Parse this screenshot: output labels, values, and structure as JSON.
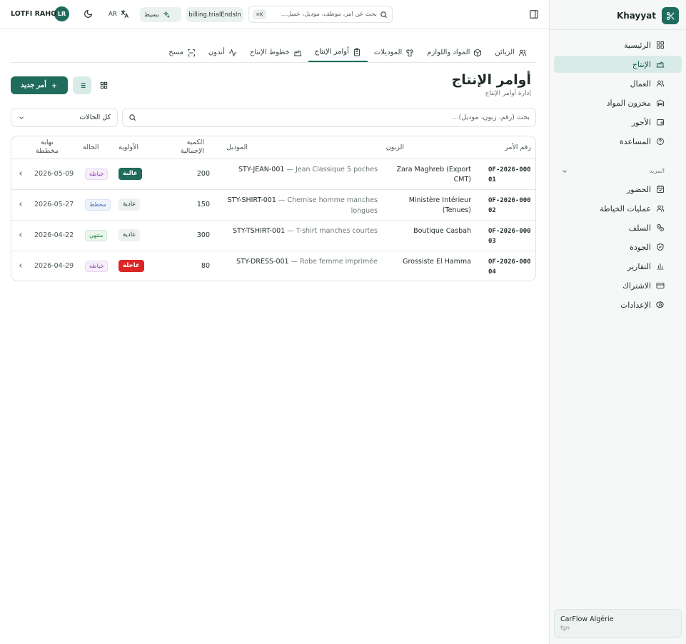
{
  "app": {
    "name": "Khayyat"
  },
  "sidebar": {
    "main_items": [
      {
        "label": "الرئيسية",
        "icon": "dashboard-icon"
      },
      {
        "label": "الإنتاج",
        "icon": "factory-icon",
        "active": true
      },
      {
        "label": "العمال",
        "icon": "users-icon"
      },
      {
        "label": "مخزون المواد",
        "icon": "warehouse-icon"
      },
      {
        "label": "الأجور",
        "icon": "wallet-icon"
      },
      {
        "label": "المساعدة",
        "icon": "help-circle-icon"
      }
    ],
    "more_label": "المزيد",
    "more_items": [
      {
        "label": "الحضور",
        "icon": "calendar-check-icon"
      },
      {
        "label": "عمليات الخياطة",
        "icon": "users-icon"
      },
      {
        "label": "السلف",
        "icon": "coins-icon"
      },
      {
        "label": "الجودة",
        "icon": "shield-check-icon"
      },
      {
        "label": "التقارير",
        "icon": "bar-chart-icon"
      },
      {
        "label": "الاشتراك",
        "icon": "credit-card-icon"
      },
      {
        "label": "الإعدادات",
        "icon": "settings-icon"
      }
    ],
    "org": {
      "name": "CarFlow Algérie",
      "sub": "fgn"
    }
  },
  "topbar": {
    "search_placeholder": "بحث عن أمر، موظف، موديل، عميل...",
    "search_shortcut": "⌘K",
    "billing_label": "billing.trialEndsIn",
    "mode_label": "بسيط",
    "language": "AR",
    "user_initials": "LR",
    "user_name": "LOTFI RAHO"
  },
  "tabs": [
    {
      "label": "الزبائن",
      "icon": "users-icon"
    },
    {
      "label": "المواد واللوازم",
      "icon": "package-icon"
    },
    {
      "label": "الموديلات",
      "icon": "shirt-icon"
    },
    {
      "label": "أوامر الإنتاج",
      "icon": "clipboard-icon",
      "active": true
    },
    {
      "label": "خطوط الإنتاج",
      "icon": "factory-icon"
    },
    {
      "label": "أندون",
      "icon": "activity-icon"
    },
    {
      "label": "مسح",
      "icon": "scan-icon"
    }
  ],
  "page": {
    "title": "أوامر الإنتاج",
    "subtitle": "إدارة أوامر الإنتاج",
    "new_button": "أمر جديد"
  },
  "filters": {
    "search_placeholder": "بحث (رقم، زبون، موديل)...",
    "status_value": "كل الحالات"
  },
  "table": {
    "headers": {
      "order": "رقم الأمر",
      "client": "الزبون",
      "model": "الموديل",
      "qty": "الكمية الإجمالية",
      "priority": "الأولوية",
      "status": "الحالة",
      "end": "نهاية مخططة"
    },
    "rows": [
      {
        "order": "OF-2026-00001",
        "client": "Zara Maghreb (Export CMT)",
        "model_code": "STY-JEAN-001",
        "model_name": "Jean Classique 5 poches",
        "qty": "200",
        "priority": "عالية",
        "priority_kind": "high",
        "status": "خياطة",
        "status_kind": "sewing",
        "end": "2026-05-09"
      },
      {
        "order": "OF-2026-00002",
        "client": "Ministère Intérieur (Tenues)",
        "model_code": "STY-SHIRT-001",
        "model_name": "Chemise homme manches longues",
        "qty": "150",
        "priority": "عادية",
        "priority_kind": "normal",
        "status": "مخطط",
        "status_kind": "planned",
        "end": "2026-05-27"
      },
      {
        "order": "OF-2026-00003",
        "client": "Boutique Casbah",
        "model_code": "STY-TSHIRT-001",
        "model_name": "T-shirt manches courtes",
        "qty": "300",
        "priority": "عادية",
        "priority_kind": "normal",
        "status": "منتهي",
        "status_kind": "done",
        "end": "2026-04-22"
      },
      {
        "order": "OF-2026-00004",
        "client": "Grossiste El Hamma",
        "model_code": "STY-DRESS-001",
        "model_name": "Robe femme imprimée",
        "qty": "80",
        "priority": "عاجلة",
        "priority_kind": "urgent",
        "status": "خياطة",
        "status_kind": "sewing",
        "end": "2026-04-29"
      }
    ]
  },
  "colors": {
    "brand": "#1f6b5c",
    "brand_soft": "#d9ebe6",
    "urgent": "#dc2626",
    "sewing": "#8e3bb3",
    "planned": "#3b68a8",
    "done": "#2f8a45"
  }
}
